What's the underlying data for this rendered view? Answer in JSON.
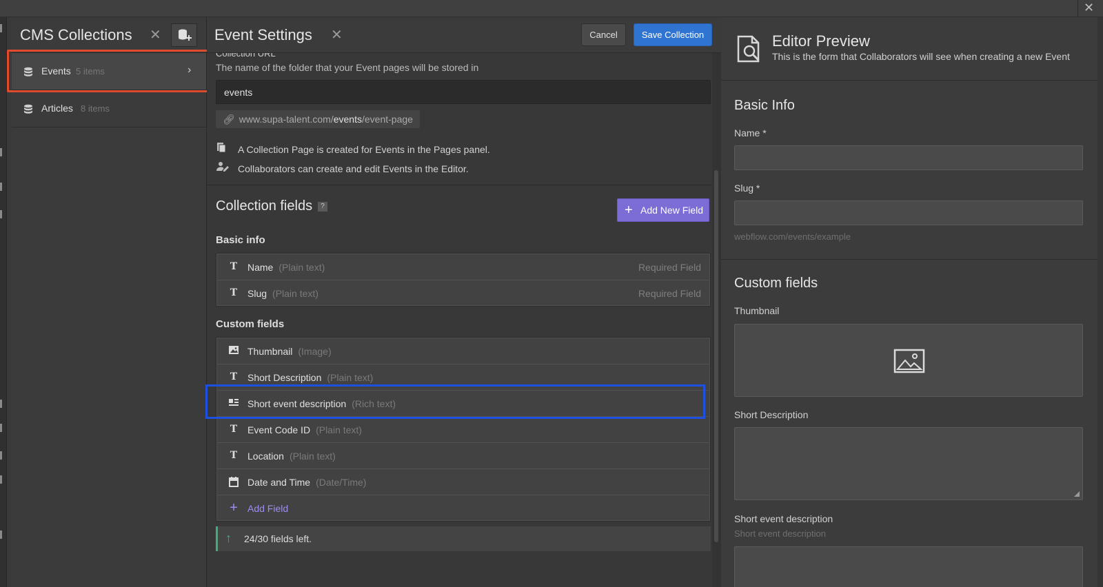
{
  "window": {
    "close_glyph": "✕"
  },
  "cms": {
    "title": "CMS Collections",
    "close_glyph": "✕",
    "collections": [
      {
        "name": "Events",
        "count": "5 items",
        "active": true
      },
      {
        "name": "Articles",
        "count": "8 items",
        "active": false
      }
    ]
  },
  "settings": {
    "title": "Event Settings",
    "close_glyph": "✕",
    "cancel_label": "Cancel",
    "save_label": "Save Collection",
    "url_label": "Collection URL",
    "url_help": "The name of the folder that your Event pages will be stored in",
    "slug_value": "events",
    "url_prefix": "www.supa-talent.com/",
    "url_slug": "events",
    "url_suffix": "/event-page",
    "info_page": "A Collection Page is created for Events in the Pages panel.",
    "info_collab": "Collaborators can create and edit Events in the Editor.",
    "fields_title": "Collection fields",
    "help_badge": "?",
    "add_new_field_label": "Add New Field",
    "basic_info_title": "Basic info",
    "basic_fields": [
      {
        "icon": "text-icon",
        "name": "Name",
        "type": "(Plain text)",
        "req": "Required Field"
      },
      {
        "icon": "text-icon",
        "name": "Slug",
        "type": "(Plain text)",
        "req": "Required Field"
      }
    ],
    "custom_fields_title": "Custom fields",
    "custom_fields": [
      {
        "icon": "image-icon",
        "name": "Thumbnail",
        "type": "(Image)"
      },
      {
        "icon": "text-icon",
        "name": "Short Description",
        "type": "(Plain text)"
      },
      {
        "icon": "rich-text-icon",
        "name": "Short event description",
        "type": "(Rich text)"
      },
      {
        "icon": "text-icon",
        "name": "Event Code ID",
        "type": "(Plain text)"
      },
      {
        "icon": "text-icon",
        "name": "Location",
        "type": "(Plain text)"
      },
      {
        "icon": "calendar-icon",
        "name": "Date and Time",
        "type": "(Date/Time)"
      }
    ],
    "add_field_label": "Add Field",
    "fields_left": "24/30 fields left."
  },
  "preview": {
    "title": "Editor Preview",
    "subtitle": "This is the form that Collaborators will see when creating a new Event",
    "basic_title": "Basic Info",
    "name_label": "Name *",
    "slug_label": "Slug *",
    "slug_hint": "webflow.com/events/example",
    "custom_title": "Custom fields",
    "thumbnail_label": "Thumbnail",
    "short_desc_label": "Short Description",
    "short_event_label": "Short event description",
    "short_event_hint": "Short event description"
  },
  "colors": {
    "save_button": "#2f74d0",
    "add_field_button": "#7b6cd6",
    "highlight_red": "#e04b2e",
    "highlight_blue": "#1d4fe0",
    "fields_left_accent": "#3fae7d"
  }
}
